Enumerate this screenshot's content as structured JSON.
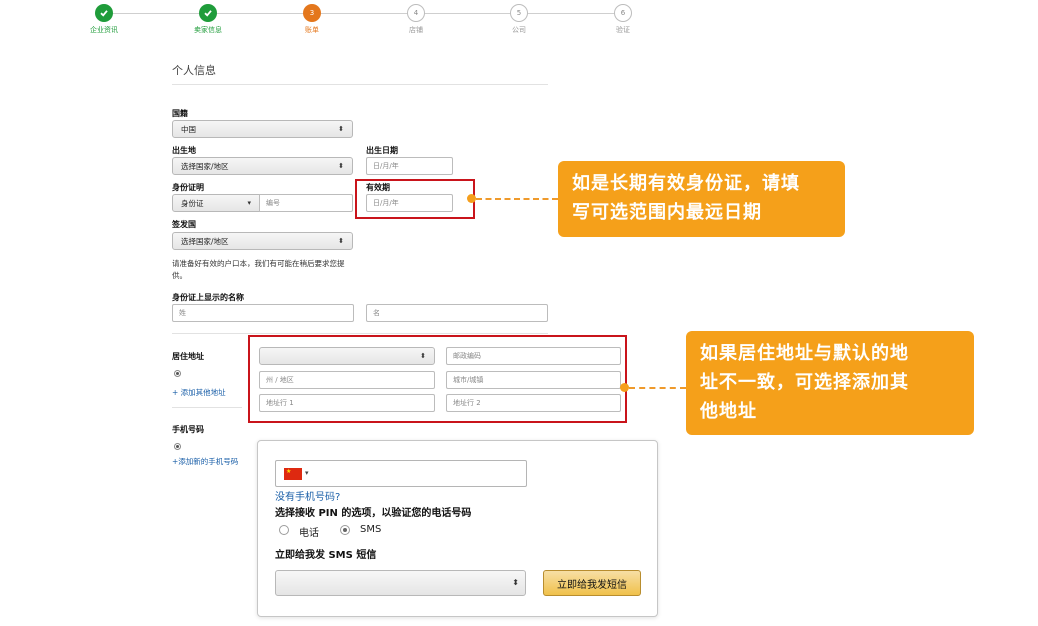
{
  "stepper": [
    {
      "label": "企业资讯",
      "state": "done",
      "num": ""
    },
    {
      "label": "卖家信息",
      "state": "done",
      "num": ""
    },
    {
      "label": "账单",
      "state": "current",
      "num": "3"
    },
    {
      "label": "店铺",
      "state": "todo",
      "num": "4"
    },
    {
      "label": "公司",
      "state": "todo",
      "num": "5"
    },
    {
      "label": "验证",
      "state": "todo",
      "num": "6"
    }
  ],
  "form": {
    "section_title": "个人信息",
    "nationality": {
      "label": "国籍",
      "value": "中国"
    },
    "birthplace": {
      "label": "出生地",
      "value": "选择国家/地区"
    },
    "birthdate": {
      "label": "出生日期",
      "placeholder": "日/月/年"
    },
    "id_proof": {
      "label": "身份证明",
      "type_value": "身份证",
      "number_placeholder": "编号"
    },
    "expiry": {
      "label": "有效期",
      "placeholder": "日/月/年"
    },
    "issuing_country": {
      "label": "签发国",
      "value": "选择国家/地区"
    },
    "note": "请准备好有效的户口本，我们有可能在稍后要求您提供。",
    "name_on_id": {
      "label": "身份证上显示的名称",
      "surname_placeholder": "姓",
      "given_placeholder": "名"
    },
    "address": {
      "label": "居住地址",
      "postal_placeholder": "邮政编码",
      "state_placeholder": "州 / 地区",
      "city_placeholder": "城市/城镇",
      "line1_placeholder": "地址行 1",
      "line2_placeholder": "地址行 2",
      "add_link": "+ 添加其他地址"
    },
    "phone": {
      "label": "手机号码",
      "add_link": "+添加新的手机号码",
      "no_phone_link": "没有手机号码?",
      "pin_label": "选择接收 PIN 的选项，以验证您的电话号码",
      "opt_call": "电话",
      "opt_sms": "SMS",
      "sms_label": "立即给我发 SMS 短信",
      "send_button": "立即给我发短信"
    }
  },
  "callouts": {
    "expiry_line1": "如是长期有效身份证，请填",
    "expiry_line2": "写可选范围内最远日期",
    "address_line1": "如果居住地址与默认的地",
    "address_line2": "址不一致，可选择添加其",
    "address_line3": "他地址"
  },
  "colors": {
    "done": "#1f9c3a",
    "current": "#e4771c",
    "highlight": "#c9141b",
    "callout": "#f5a01a",
    "link": "#1a5fa8"
  }
}
